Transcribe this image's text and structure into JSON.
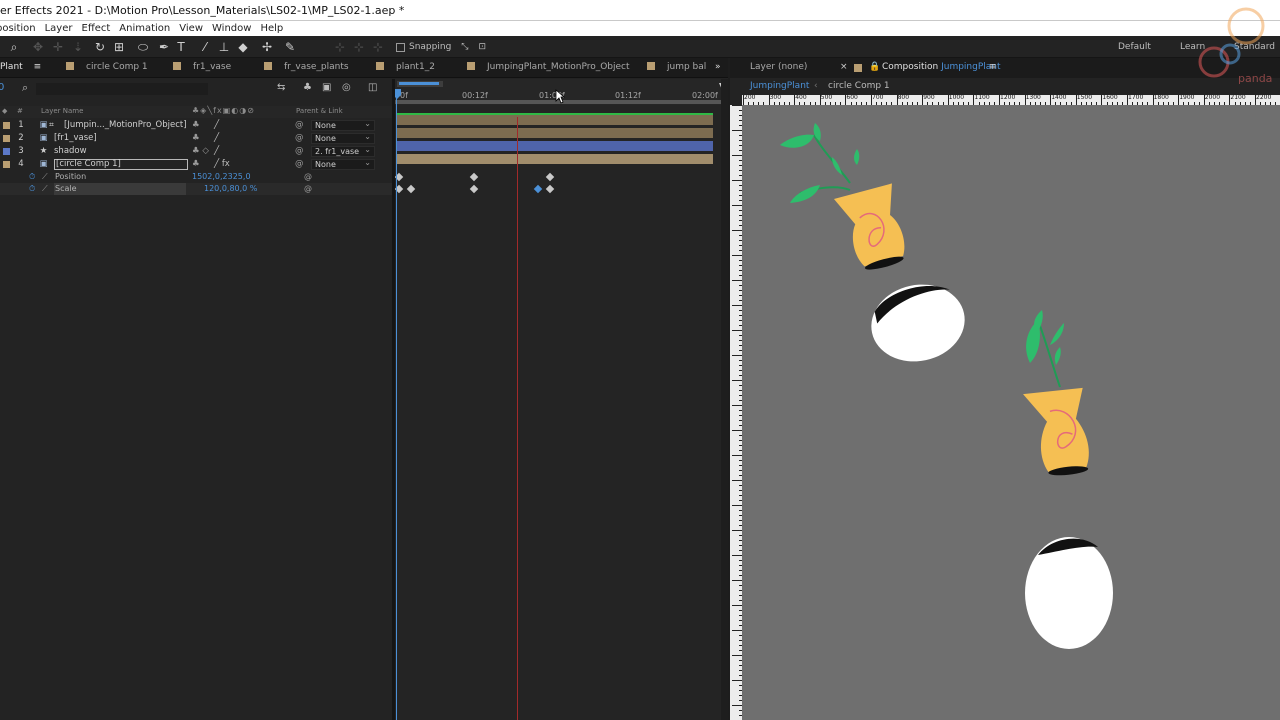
{
  "title_bar": {
    "text": "er Effects 2021 - D:\\Motion Pro\\Lesson_Materials\\LS02-1\\MP_LS02-1.aep *"
  },
  "menu": [
    "position",
    "Layer",
    "Effect",
    "Animation",
    "View",
    "Window",
    "Help"
  ],
  "toolbar": {
    "tools": [
      "selection-tool",
      "hand-tool",
      "zoom-tool",
      "rotate-tool",
      "camera-orbit-tool",
      "pan-tool",
      "dolly-tool",
      "rotation-tool",
      "pan-behind-tool",
      "ellipse-tool",
      "type-tool",
      "pen-tool",
      "brush-tool",
      "clone-stamp-tool",
      "eraser-tool",
      "roto-brush-tool",
      "puppet-pin-tool"
    ],
    "snapping_label": "Snapping",
    "workspaces": [
      "Default",
      "Learn",
      "Standard"
    ]
  },
  "timeline": {
    "tabs": [
      "Plant",
      "circle Comp 1",
      "fr1_vase",
      "fr_vase_plants",
      "plant1_2",
      "JumpingPlant_MotionPro_Object",
      "jump bal"
    ],
    "columns": {
      "num": "#",
      "layer_name": "Layer Name",
      "parent": "Parent & Link"
    },
    "layers": [
      {
        "num": "1",
        "name": "[Jumpin..._MotionPro_Object]",
        "parent": "None",
        "label_color": "#b99e72"
      },
      {
        "num": "2",
        "name": "[fr1_vase]",
        "parent": "None",
        "label_color": "#b99e72"
      },
      {
        "num": "3",
        "name": "shadow",
        "parent": "2. fr1_vase",
        "label_color": "#5b78c8"
      },
      {
        "num": "4",
        "name": "[circle Comp 1]",
        "parent": "None",
        "label_color": "#b99e72"
      }
    ],
    "properties": [
      {
        "name": "Position",
        "value": "1502,0,2325,0"
      },
      {
        "name": "Scale",
        "value": "120,0,80,0 %"
      }
    ],
    "ruler_labels": [
      "0f",
      "00:12f",
      "01:00f",
      "01:12f",
      "02:00f"
    ]
  },
  "composition": {
    "layer_tab": "Layer  (none)",
    "comp_tab_prefix": "Composition",
    "comp_tab_name": "JumpingPlant",
    "breadcrumb": [
      "JumpingPlant",
      "circle Comp 1"
    ],
    "ruler_labels": [
      "200",
      "300",
      "400",
      "500",
      "600",
      "700",
      "800",
      "900",
      "1000",
      "1100",
      "1200",
      "1300",
      "1400",
      "1500",
      "1600",
      "1700",
      "1800",
      "1900",
      "2000",
      "2100",
      "2200"
    ]
  },
  "watermark": {
    "text": "panda"
  },
  "colors": {
    "accent": "#4b90d7",
    "track_tan": "#7f6e52",
    "track_blue": "#4e63a8",
    "canvas": "#6f6f6f",
    "vase": "#f5bf53",
    "leaf": "#2ebd6c"
  }
}
